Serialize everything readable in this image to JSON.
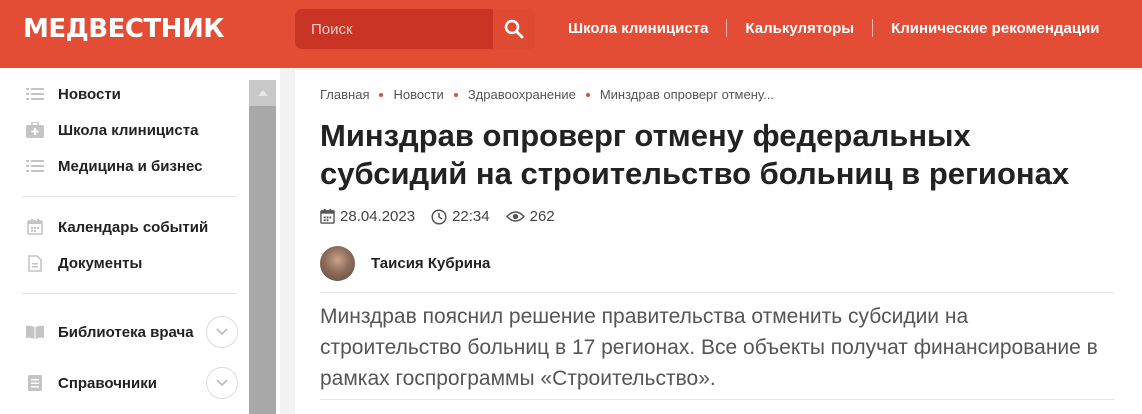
{
  "header": {
    "logo": "МЕДВЕСТНИК",
    "search_placeholder": "Поиск",
    "nav": [
      "Школа клинициста",
      "Калькуляторы",
      "Клинические рекомендации"
    ]
  },
  "sidebar": {
    "items": [
      {
        "label": "Новости",
        "icon": "list-icon"
      },
      {
        "label": "Школа клинициста",
        "icon": "medkit-icon"
      },
      {
        "label": "Медицина и бизнес",
        "icon": "list-icon"
      },
      {
        "label": "Календарь событий",
        "icon": "calendar-icon"
      },
      {
        "label": "Документы",
        "icon": "document-icon"
      },
      {
        "label": "Библиотека врача",
        "icon": "book-icon"
      },
      {
        "label": "Справочники",
        "icon": "directory-icon"
      }
    ]
  },
  "article": {
    "breadcrumbs": [
      "Главная",
      "Новости",
      "Здравоохранение",
      "Минздрав опроверг отмену..."
    ],
    "title": "Минздрав опроверг отмену федеральных субсидий на строительство больниц в регионах",
    "date": "28.04.2023",
    "time": "22:34",
    "views": "262",
    "author": "Таисия Кубрина",
    "lead": "Минздрав пояснил решение правительства отменить субсидии на строительство больниц в 17 регионах. Все объекты получат финансирование в рамках госпрограммы «Строительство»."
  },
  "colors": {
    "brand": "#e34d36",
    "search_bg": "#c93424",
    "breadcrumb_dot": "#e34d36"
  }
}
